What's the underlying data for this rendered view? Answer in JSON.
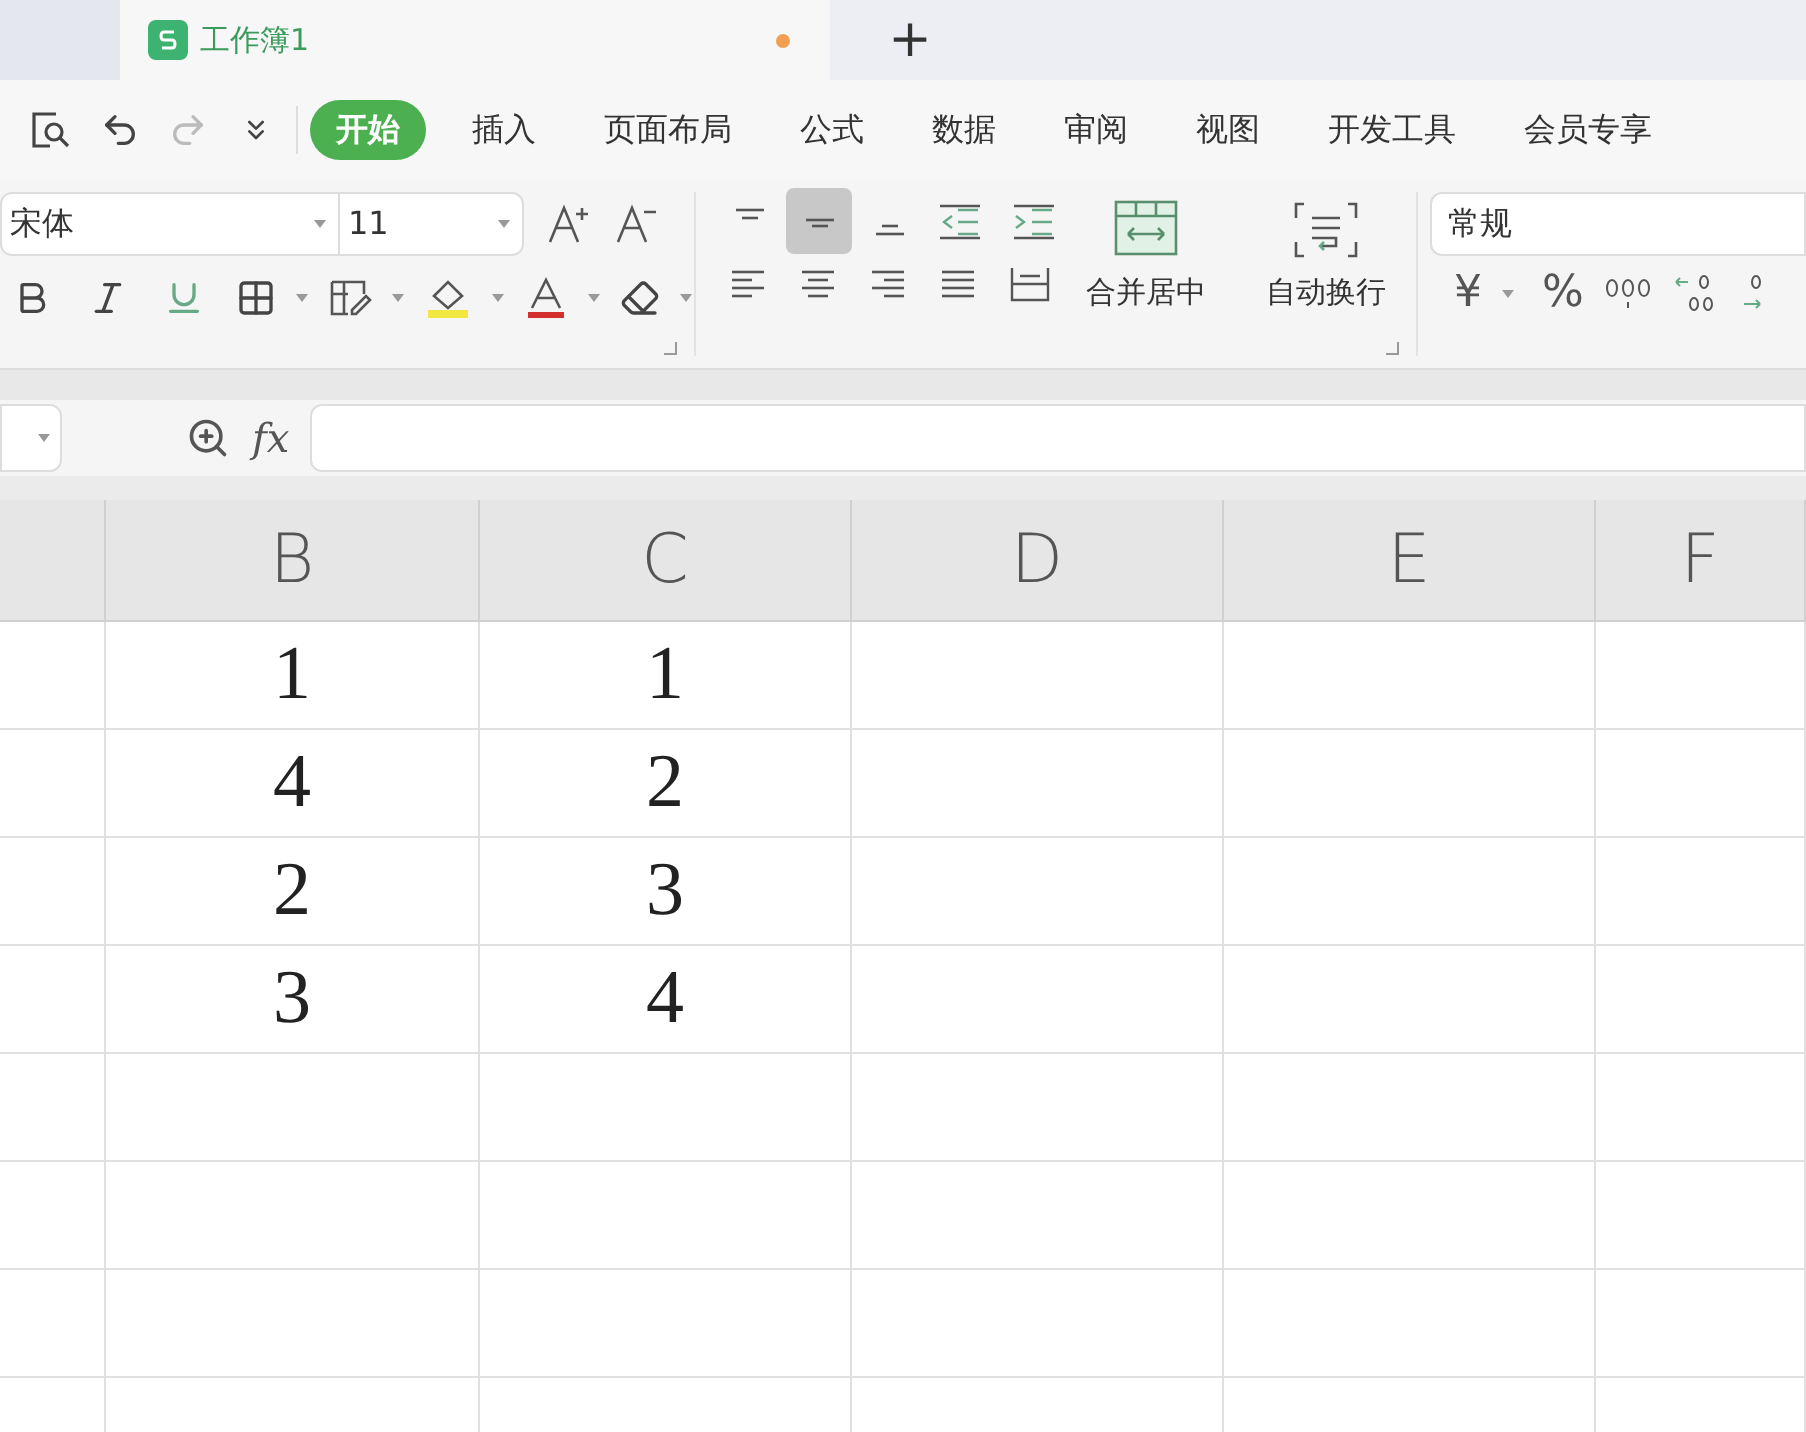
{
  "tabs": [
    {
      "title": "工作簿1",
      "modified": true,
      "selected": true
    }
  ],
  "new_tab": "+",
  "menu": [
    {
      "label": "开始",
      "selected": true
    },
    {
      "label": "插入",
      "selected": false
    },
    {
      "label": "页面布局",
      "selected": false
    },
    {
      "label": "公式",
      "selected": false
    },
    {
      "label": "数据",
      "selected": false
    },
    {
      "label": "审阅",
      "selected": false
    },
    {
      "label": "视图",
      "selected": false
    },
    {
      "label": "开发工具",
      "selected": false
    },
    {
      "label": "会员专享",
      "selected": false
    }
  ],
  "ribbon": {
    "font_name": "宋体",
    "font_size": "11",
    "vertical_align": [
      {
        "kind": "top",
        "selected": false
      },
      {
        "kind": "middle",
        "selected": true
      },
      {
        "kind": "bottom",
        "selected": false
      }
    ],
    "merge_label": "合并居中",
    "wrap_label": "自动换行",
    "number_format": "常规",
    "currency": "¥",
    "percent": "%"
  },
  "formula_bar": {
    "function_label": "fx"
  },
  "sheet": {
    "columns": [
      "B",
      "C",
      "D",
      "E",
      "F"
    ],
    "rows": [
      [
        "1",
        "1"
      ],
      [
        "4",
        "2"
      ],
      [
        "2",
        "3"
      ],
      [
        "3",
        "4"
      ]
    ]
  }
}
